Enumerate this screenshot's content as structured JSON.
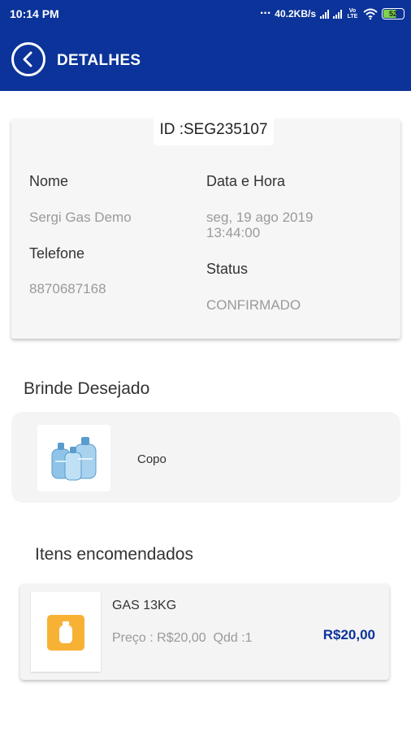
{
  "status_bar": {
    "time": "10:14 PM",
    "dots": "...",
    "network_speed": "40.2KB/s",
    "volte": "Vo LTE",
    "battery": "52"
  },
  "header": {
    "title": "DETALHES",
    "back_icon": "chevron-left-circle-icon",
    "background": "#0b3399"
  },
  "order": {
    "id_text": "ID :SEG235107",
    "name_label": "Nome",
    "name_value": "Sergi Gas Demo",
    "phone_label": "Telefone",
    "phone_value": "8870687168",
    "datetime_label": "Data e Hora",
    "datetime_value_line1": "seg, 19 ago 2019",
    "datetime_value_line2": "13:44:00",
    "status_label": "Status",
    "status_value": "CONFIRMADO"
  },
  "gift": {
    "section_title": "Brinde Desejado",
    "name": "Copo",
    "image_icon": "water-jugs-icon"
  },
  "items": {
    "section_title": "Itens encomendados",
    "list": [
      {
        "name": "GAS 13KG",
        "price_text": "Preço : R$20,00",
        "qty_text": "Qdd :1",
        "total": "R$20,00",
        "icon": "gas-cylinder-icon"
      }
    ]
  },
  "colors": {
    "primary": "#0b3399",
    "accent": "#f7b236",
    "muted_text": "#9a9a9a"
  }
}
